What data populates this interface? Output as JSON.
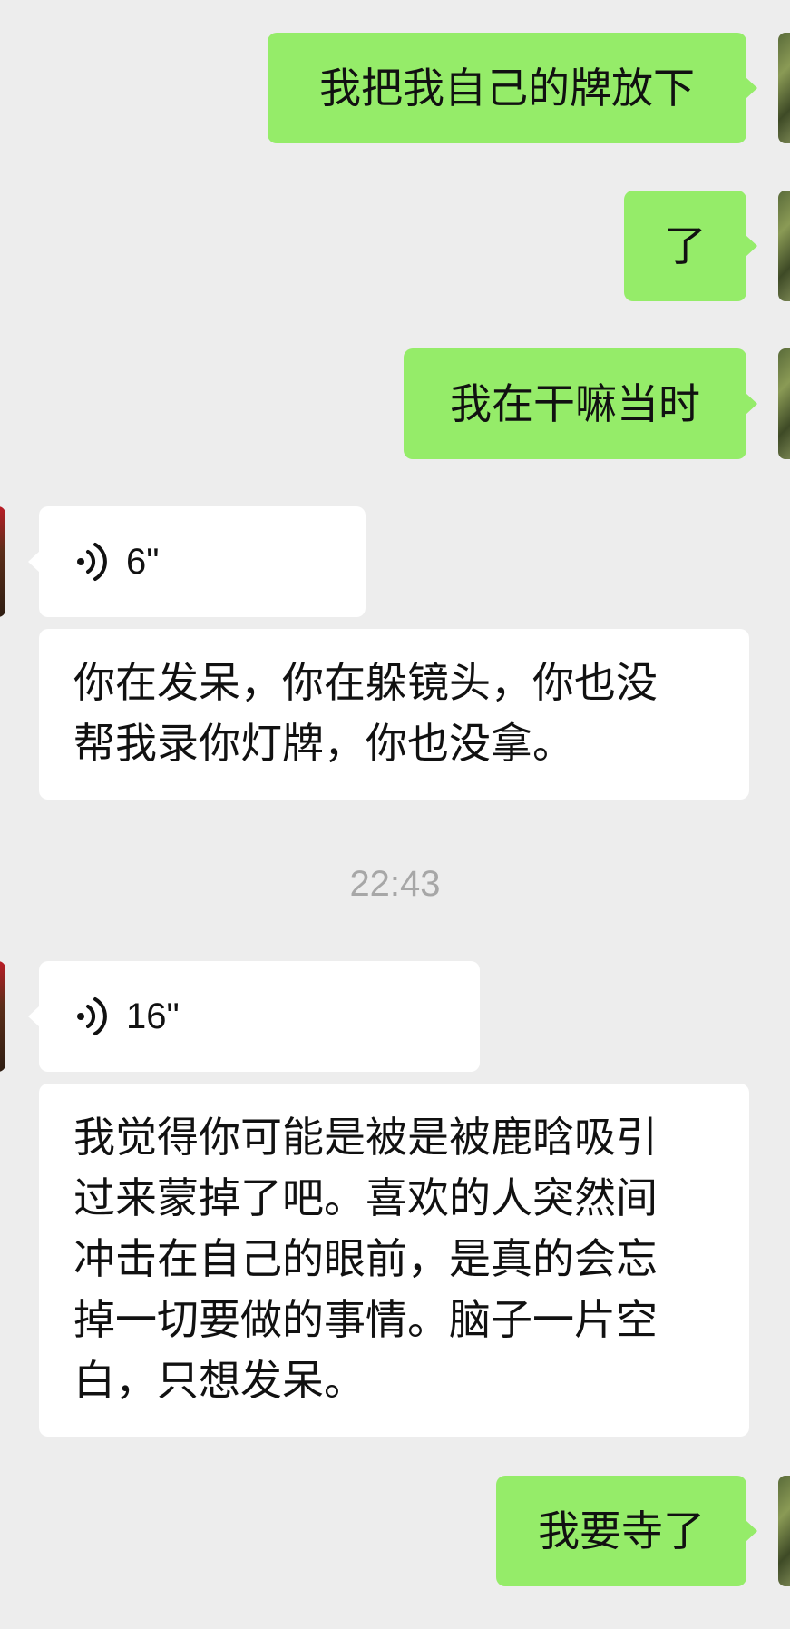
{
  "messages": [
    {
      "side": "out",
      "text": "我把我自己的牌放下"
    },
    {
      "side": "out",
      "text": "了"
    },
    {
      "side": "out",
      "text": "我在干嘛当时"
    },
    {
      "side": "in",
      "type": "voice",
      "duration": "6\""
    },
    {
      "side": "in",
      "lines": [
        "你在发呆，你在躲镜头，你也没",
        "帮我录你灯牌，你也没拿。"
      ]
    },
    {
      "side": "in",
      "type": "voice",
      "duration": "16\""
    },
    {
      "side": "in",
      "lines": [
        "我觉得你可能是被是被鹿晗吸引",
        "过来蒙掉了吧。喜欢的人突然间",
        "冲击在自己的眼前，是真的会忘",
        "掉一切要做的事情。脑子一片空",
        "白，只想发呆。"
      ]
    },
    {
      "side": "out",
      "text": "我要寺了"
    }
  ],
  "timestamp": "22:43",
  "icons": {
    "voice": "voice-wave-icon"
  },
  "colors": {
    "background": "#ededed",
    "outgoing_bubble": "#95ec69",
    "incoming_bubble": "#ffffff",
    "timestamp": "#a7a7a7"
  }
}
